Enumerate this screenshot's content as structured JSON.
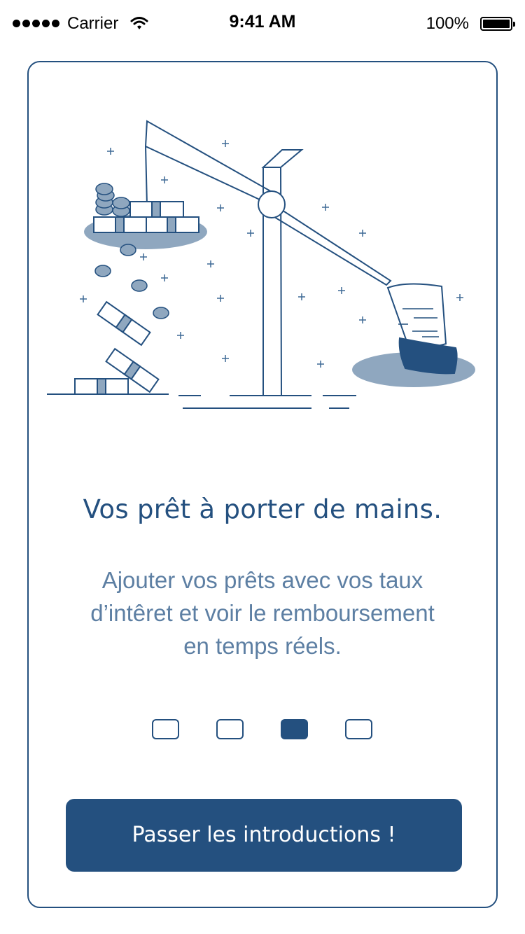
{
  "status_bar": {
    "carrier": "Carrier",
    "time": "9:41 AM",
    "battery": "100%"
  },
  "onboarding": {
    "title": "Vos prêt à porter de mains.",
    "description_lines": [
      "Ajouter vos prêts avec vos taux",
      "d’intêret et voir le remboursement",
      "en temps réels."
    ],
    "page_count": 4,
    "active_page_index": 2,
    "skip_label": "Passer les introductions !"
  },
  "colors": {
    "primary": "#24507f",
    "accent_light": "#8fa7bf",
    "text_secondary": "#5d7fa3"
  }
}
